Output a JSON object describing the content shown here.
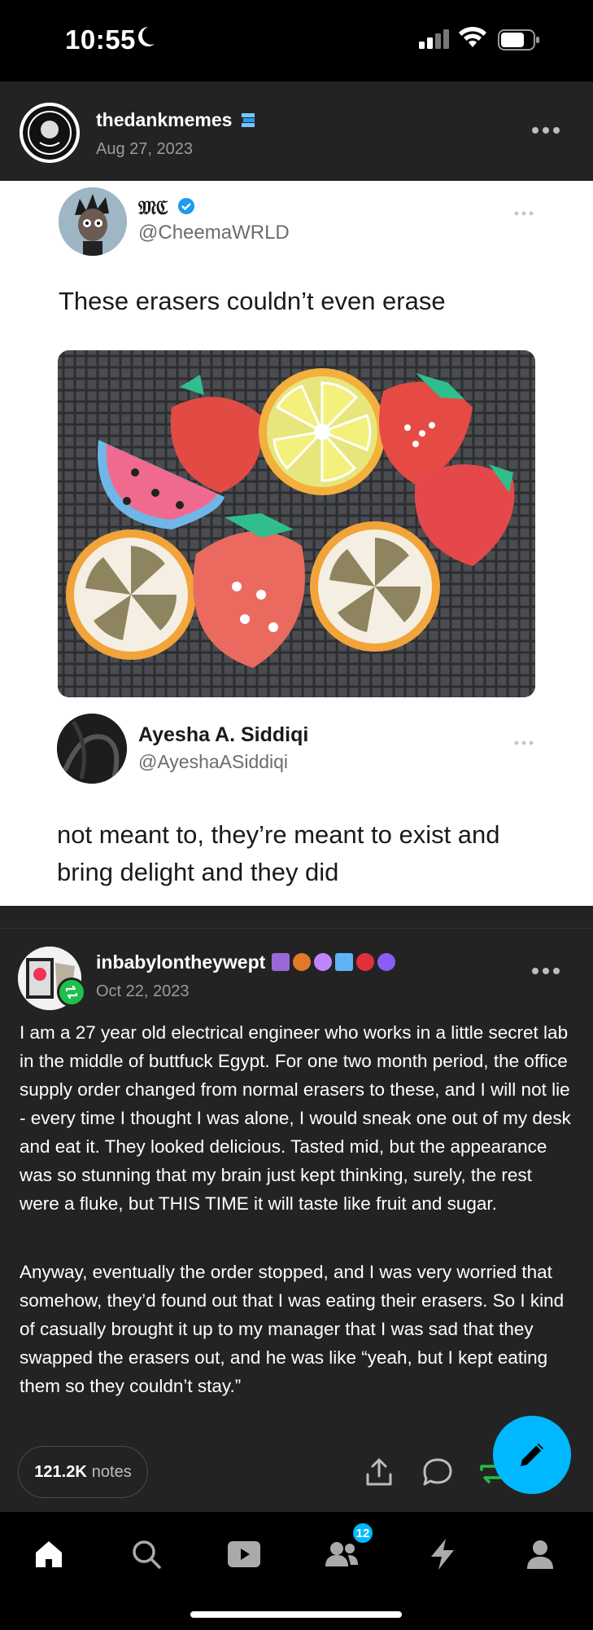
{
  "status_bar": {
    "time": "10:55"
  },
  "post": {
    "username": "thedankmemes",
    "date": "Aug 27, 2023",
    "embedded_tweet": {
      "tweet1": {
        "display_name": "𝔐ℭ",
        "handle": "@CheemaWRLD",
        "text": "These erasers couldn’t even erase"
      },
      "tweet2": {
        "display_name": "Ayesha A. Siddiqi",
        "handle": "@AyeshaASiddiqi",
        "text": "not meant to, they’re meant to exist and bring delight and they did"
      }
    }
  },
  "reblog": {
    "username": "inbabylontheywept",
    "date": "Oct 22, 2023",
    "paragraphs": [
      "I am a 27 year old electrical engineer who works in a little secret lab in the middle of buttfuck Egypt. For one two month period, the office supply order changed from normal erasers to these, and I will not lie - every time I thought I was alone, I would sneak one out of my desk and eat it. They looked delicious. Tasted mid, but the appearance was so stunning that my brain just kept thinking, surely, the rest were a fluke, but THIS TIME it will taste like fruit and sugar.",
      "Anyway, eventually the order stopped, and I was very worried that somehow, they’d found out that I was eating their erasers. So I kind of casually brought it up to my manager that I was sad that they swapped the erasers out, and he was like “yeah, but I kept eating them so they couldn’t stay.”"
    ]
  },
  "footer": {
    "notes_count": "121.2K",
    "notes_label": "notes"
  },
  "bottom_nav": {
    "items": [
      "home-icon",
      "search-icon",
      "video-icon",
      "community-icon",
      "activity-icon",
      "account-icon"
    ],
    "community_badge": "12"
  },
  "colors": {
    "accent": "#00b8ff",
    "reblog_green": "#1fbf4b",
    "card_bg": "#232323"
  }
}
